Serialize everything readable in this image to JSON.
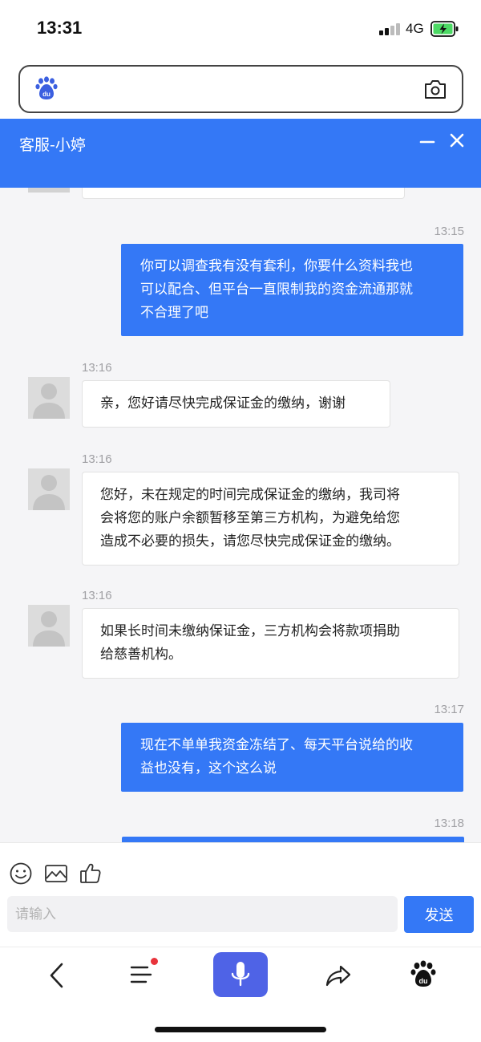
{
  "status_bar": {
    "time": "13:31",
    "network": "4G"
  },
  "chat": {
    "title": "客服-小婷",
    "messages": [
      {
        "side": "out",
        "time": "13:15",
        "lines": [
          "你可以调查我有没有套利，你要什么资料我也",
          "可以配合、但平台一直限制我的资金流通那就",
          "不合理了吧"
        ]
      },
      {
        "side": "in",
        "time": "13:16",
        "lines": [
          "亲，您好请尽快完成保证金的缴纳，谢谢"
        ]
      },
      {
        "side": "in",
        "time": "13:16",
        "lines": [
          "您好，未在规定的时间完成保证金的缴纳，我司将",
          "会将您的账户余额暂移至第三方机构，为避免给您",
          "造成不必要的损失，请您尽快完成保证金的缴纳。"
        ]
      },
      {
        "side": "in",
        "time": "13:16",
        "lines": [
          "如果长时间未缴纳保证金，三方机构会将款项捐助",
          "给慈善机构。"
        ]
      },
      {
        "side": "out",
        "time": "13:17",
        "lines": [
          "现在不单单我资金冻结了、每天平台说给的收",
          "益也没有，这个这么说"
        ]
      },
      {
        "side": "out",
        "time": "13:18",
        "lines": []
      }
    ]
  },
  "composer": {
    "placeholder": "请输入",
    "send_label": "发送"
  },
  "icons": {
    "search": [
      "baidu-paw-icon",
      "camera-icon"
    ],
    "header": [
      "minimize-icon",
      "close-icon"
    ],
    "tools": [
      "emoji-icon",
      "image-icon",
      "thumbs-up-icon"
    ],
    "nav": [
      "back-icon",
      "menu-icon",
      "mic-icon",
      "share-icon",
      "baidu-icon"
    ]
  },
  "colors": {
    "accent": "#3478f6",
    "mic": "#4f63e6",
    "notification": "#e8333b"
  }
}
